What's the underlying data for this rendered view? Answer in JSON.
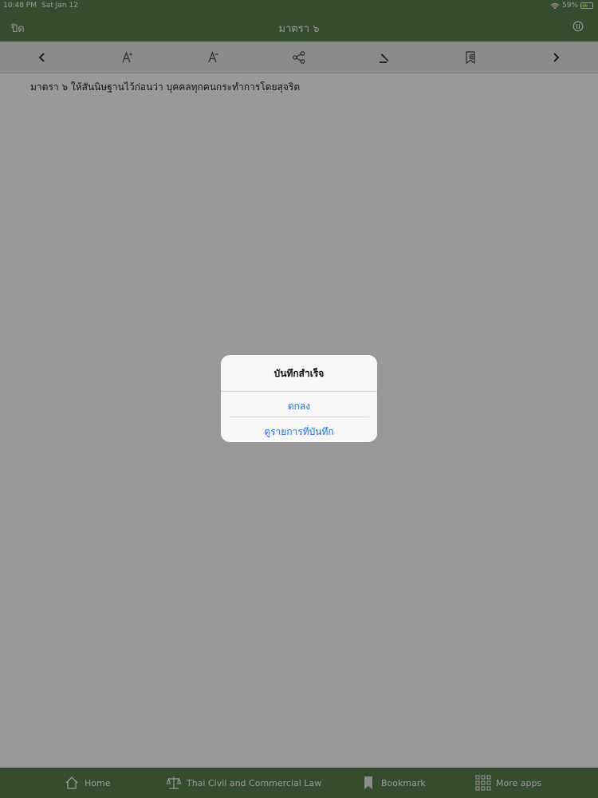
{
  "status": {
    "time": "10:48 PM",
    "date": "Sat Jan 12",
    "battery": "59%",
    "battery_level": 0.59
  },
  "nav": {
    "close_label": "ปิด",
    "title": "มาตรา ๖",
    "info_icon": "info-circle-icon"
  },
  "toolbar": {
    "icons": [
      "chevron-left-icon",
      "font-increase-icon",
      "font-decrease-icon",
      "share-icon",
      "gavel-icon",
      "bookmark-add-icon",
      "chevron-right-icon"
    ]
  },
  "content": {
    "article_text": "มาตรา ๖ ให้สันนิษฐานไว้ก่อนว่า บุคคลทุกคนกระทำการโดยสุจริต"
  },
  "tabs": [
    {
      "label": "Home",
      "icon": "home-icon"
    },
    {
      "label": "Thai Civil and Commercial Law",
      "icon": "scales-icon"
    },
    {
      "label": "Bookmark",
      "icon": "bookmark-icon"
    },
    {
      "label": "More apps",
      "icon": "grid-icon"
    }
  ],
  "alert": {
    "title": "บันทึกสำเร็จ",
    "ok_label": "ตกลง",
    "view_label": "ดูรายการที่บันทึก"
  },
  "colors": {
    "brand": "#5a7f4e",
    "link": "#1a73e8"
  }
}
